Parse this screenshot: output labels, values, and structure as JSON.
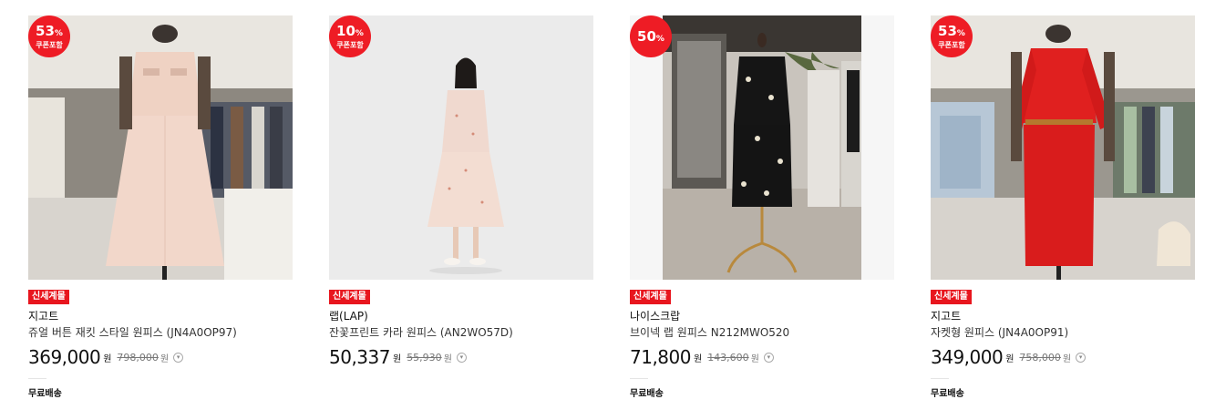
{
  "colors": {
    "badge": "#ee1c25",
    "tag": "#e8161e"
  },
  "products": [
    {
      "discount": "53",
      "percent_sign": "%",
      "coupon": "쿠폰포함",
      "tag": "신세계몰",
      "brand": "지고트",
      "name": "쥬얼 버튼 재킷 스타일 원피스 (JN4A0OP97)",
      "price": "369,000",
      "won": "원",
      "original_price": "798,000",
      "original_won": "원",
      "delivery": "무료배송"
    },
    {
      "discount": "10",
      "percent_sign": "%",
      "coupon": "쿠폰포함",
      "tag": "신세계몰",
      "brand": "랩(LAP)",
      "name": "잔꽃프린트 카라 원피스 (AN2WO57D)",
      "price": "50,337",
      "won": "원",
      "original_price": "55,930",
      "original_won": "원",
      "delivery": ""
    },
    {
      "discount": "50",
      "percent_sign": "%",
      "coupon": "",
      "tag": "신세계몰",
      "brand": "나이스크랍",
      "name": "브이넥 랩 원피스 N212MWO520",
      "price": "71,800",
      "won": "원",
      "original_price": "143,600",
      "original_won": "원",
      "delivery": "무료배송"
    },
    {
      "discount": "53",
      "percent_sign": "%",
      "coupon": "쿠폰포함",
      "tag": "신세계몰",
      "brand": "지고트",
      "name": "자켓형 원피스 (JN4A0OP91)",
      "price": "349,000",
      "won": "원",
      "original_price": "758,000",
      "original_won": "원",
      "delivery": "무료배송"
    }
  ]
}
